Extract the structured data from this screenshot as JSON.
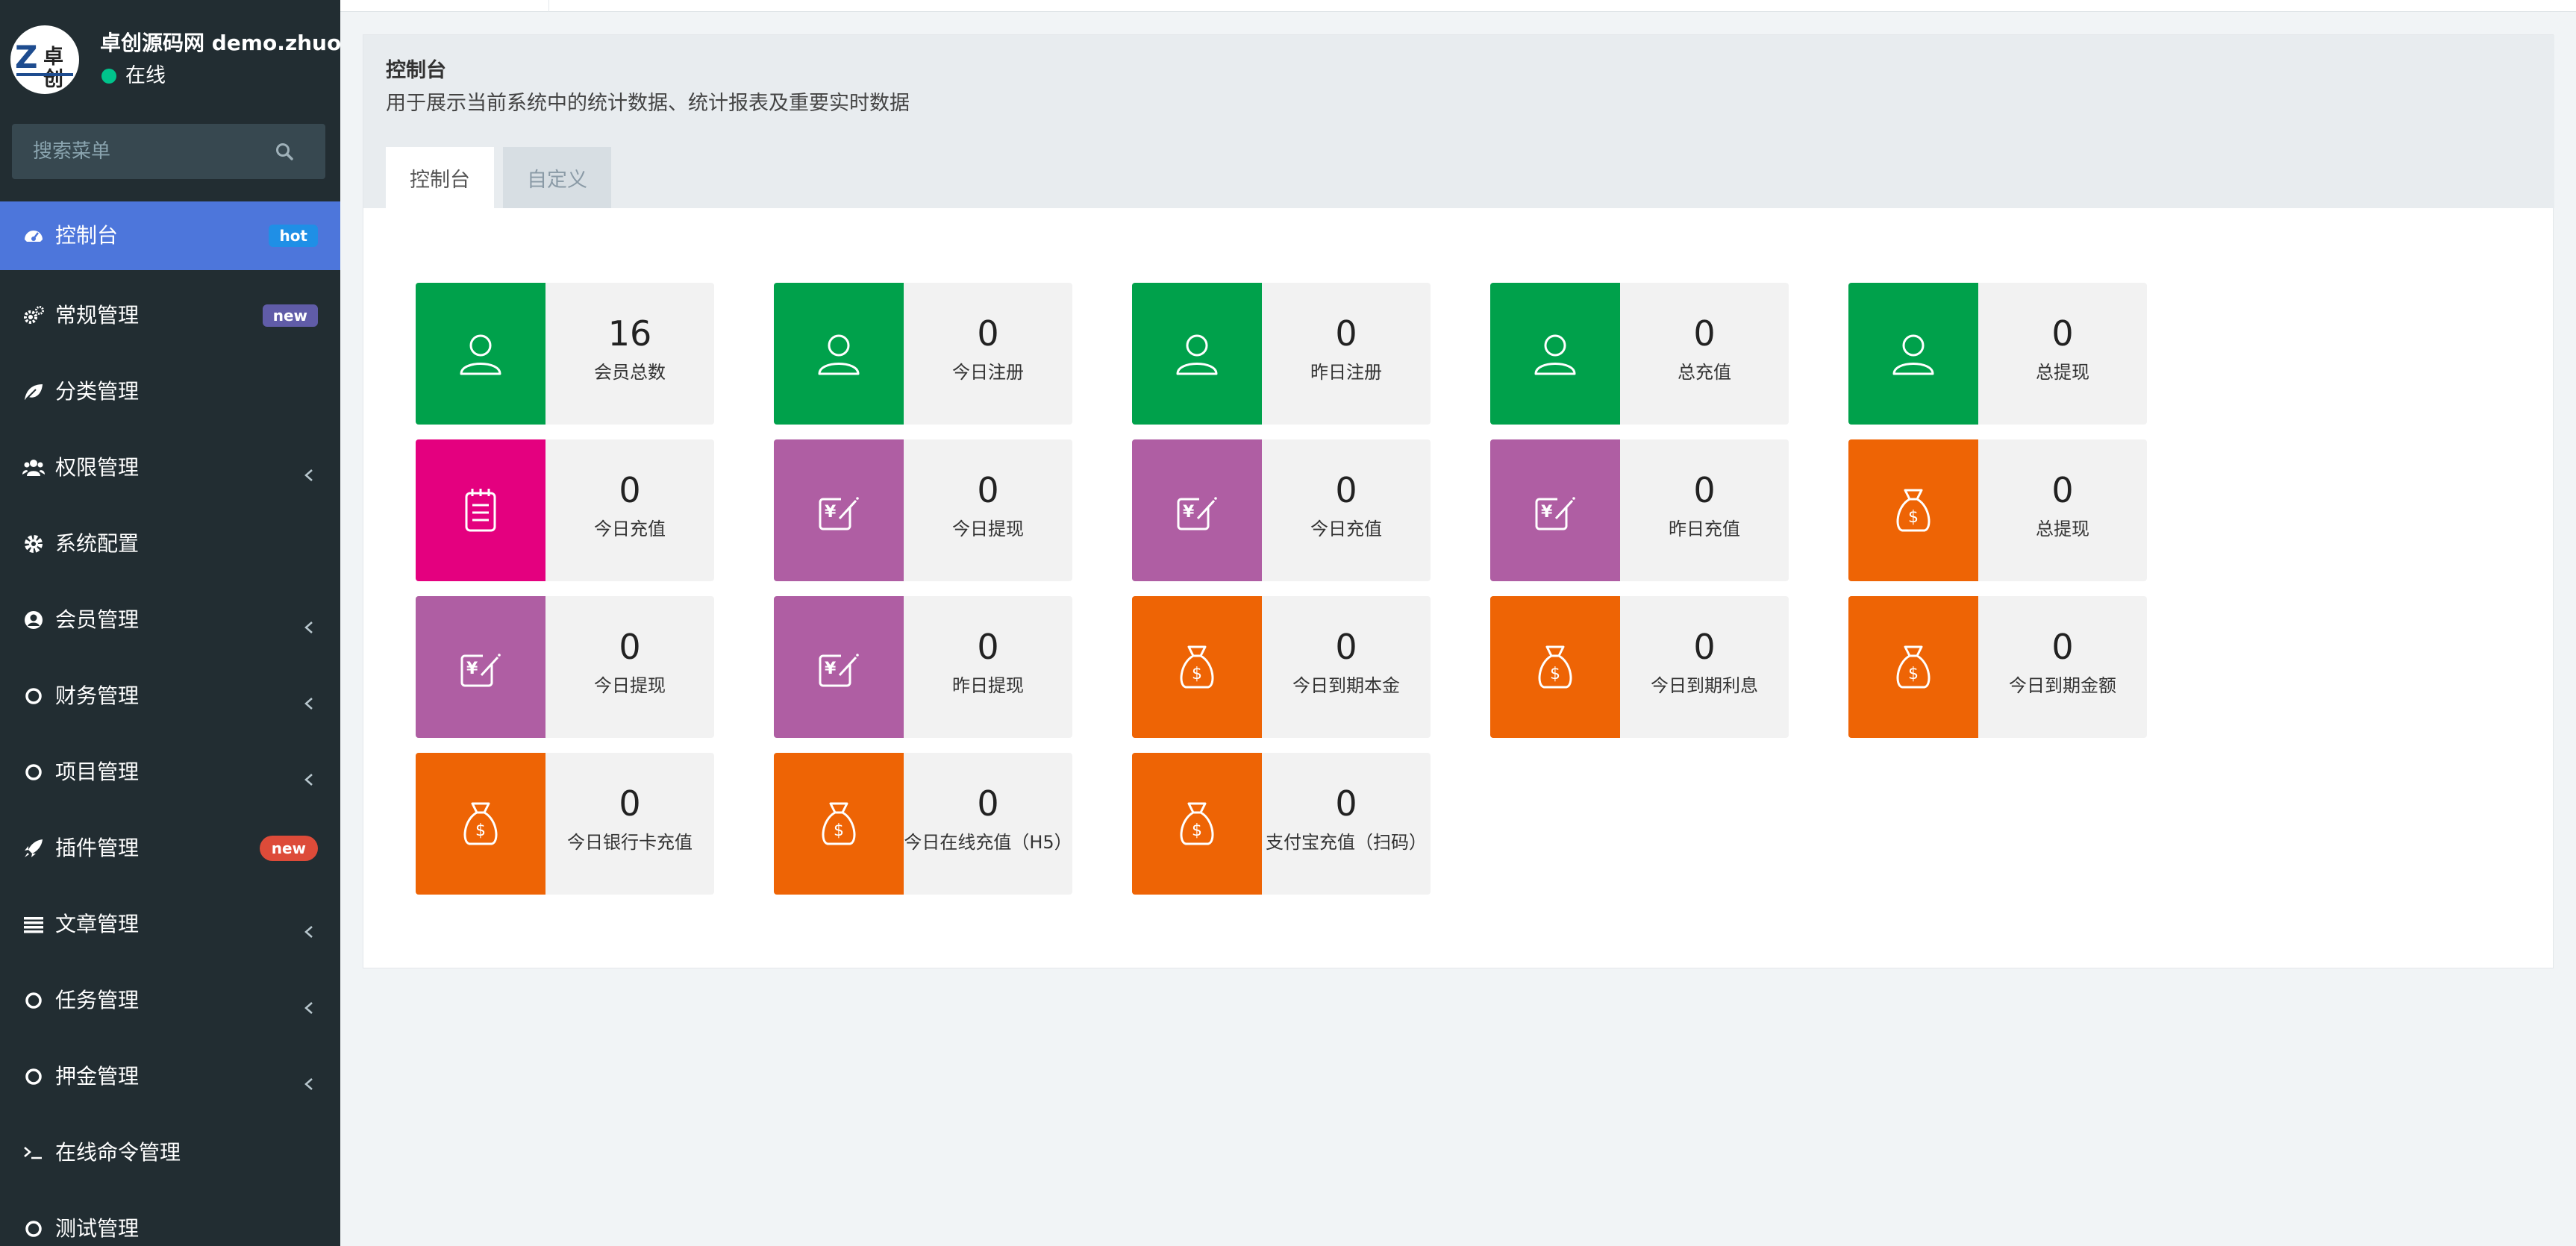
{
  "user": {
    "name": "卓创源码网 demo.zhuoch",
    "status": "在线",
    "avatar_mark": "Z",
    "avatar_text": "卓创"
  },
  "search": {
    "placeholder": "搜索菜单"
  },
  "menu": [
    {
      "label": "控制台",
      "icon": "dashboard-icon",
      "badge": "hot"
    },
    {
      "label": "常规管理",
      "icon": "gears-icon",
      "badge": "new"
    },
    {
      "label": "分类管理",
      "icon": "leaf-icon"
    },
    {
      "label": "权限管理",
      "icon": "users-icon",
      "chevron": true
    },
    {
      "label": "系统配置",
      "icon": "cog-icon"
    },
    {
      "label": "会员管理",
      "icon": "user-circle-icon",
      "chevron": true
    },
    {
      "label": "财务管理",
      "icon": "circle-icon",
      "chevron": true
    },
    {
      "label": "项目管理",
      "icon": "circle-icon",
      "chevron": true
    },
    {
      "label": "插件管理",
      "icon": "rocket-icon",
      "badge": "new"
    },
    {
      "label": "文章管理",
      "icon": "list-icon",
      "chevron": true
    },
    {
      "label": "任务管理",
      "icon": "circle-icon",
      "chevron": true
    },
    {
      "label": "押金管理",
      "icon": "circle-icon",
      "chevron": true
    },
    {
      "label": "在线命令管理",
      "icon": "terminal-icon"
    },
    {
      "label": "测试管理",
      "icon": "circle-icon"
    }
  ],
  "page": {
    "title": "控制台",
    "description": "用于展示当前系统中的统计数据、统计报表及重要实时数据",
    "tabs": [
      {
        "label": "控制台"
      },
      {
        "label": "自定义"
      }
    ]
  },
  "colors": {
    "green": "#00a14b",
    "pink": "#e4007f",
    "purple": "#af5ea3",
    "orange": "#ee6405",
    "sidebar": "#222d32",
    "active": "#4d76db"
  },
  "stats": [
    {
      "value": "16",
      "label": "会员总数",
      "color": "green",
      "icon": "user-icon"
    },
    {
      "value": "0",
      "label": "今日注册",
      "color": "green",
      "icon": "user-icon"
    },
    {
      "value": "0",
      "label": "昨日注册",
      "color": "green",
      "icon": "user-icon"
    },
    {
      "value": "0",
      "label": "总充值",
      "color": "green",
      "icon": "user-icon"
    },
    {
      "value": "0",
      "label": "总提现",
      "color": "green",
      "icon": "user-icon"
    },
    {
      "value": "0",
      "label": "今日充值",
      "color": "pink",
      "icon": "notepad-icon"
    },
    {
      "value": "0",
      "label": "今日提现",
      "color": "purple",
      "icon": "yen-edit-icon"
    },
    {
      "value": "0",
      "label": "今日充值",
      "color": "purple",
      "icon": "yen-edit-icon"
    },
    {
      "value": "0",
      "label": "昨日充值",
      "color": "purple",
      "icon": "yen-edit-icon"
    },
    {
      "value": "0",
      "label": "总提现",
      "color": "orange",
      "icon": "money-bag-icon"
    },
    {
      "value": "0",
      "label": "今日提现",
      "color": "purple",
      "icon": "yen-edit-icon"
    },
    {
      "value": "0",
      "label": "昨日提现",
      "color": "purple",
      "icon": "yen-edit-icon"
    },
    {
      "value": "0",
      "label": "今日到期本金",
      "color": "orange",
      "icon": "money-bag-icon"
    },
    {
      "value": "0",
      "label": "今日到期利息",
      "color": "orange",
      "icon": "money-bag-icon"
    },
    {
      "value": "0",
      "label": "今日到期金额",
      "color": "orange",
      "icon": "money-bag-icon"
    },
    {
      "value": "0",
      "label": "今日银行卡充值",
      "color": "orange",
      "icon": "money-bag-icon"
    },
    {
      "value": "0",
      "label": "今日在线充值（H5）",
      "color": "orange",
      "icon": "money-bag-icon"
    },
    {
      "value": "0",
      "label": "支付宝充值（扫码）",
      "color": "orange",
      "icon": "money-bag-icon"
    }
  ]
}
